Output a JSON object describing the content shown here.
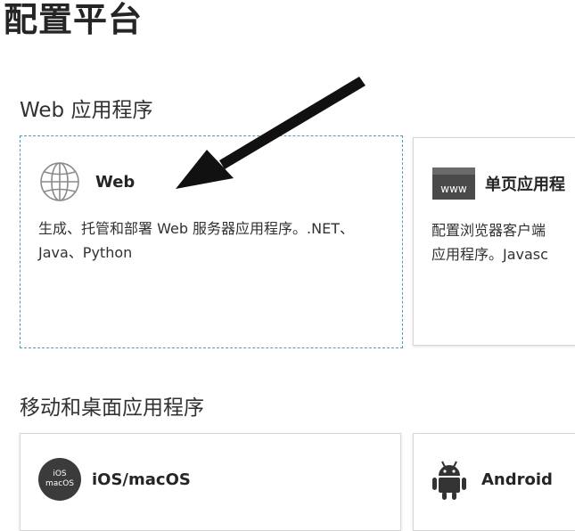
{
  "page": {
    "title": "配置平台"
  },
  "sections": {
    "web": {
      "title": "Web 应用程序",
      "cards": {
        "web": {
          "label": "Web",
          "icon": "globe-icon",
          "description": "生成、托管和部署 Web 服务器应用程序。.NET、Java、Python"
        },
        "spa": {
          "label": "单页应用程",
          "icon": "www-browser-icon",
          "icon_text": "www",
          "description_line1": "配置浏览器客户端",
          "description_line2": "应用程序。Javasc"
        }
      }
    },
    "mobile": {
      "title": "移动和桌面应用程序",
      "cards": {
        "ios": {
          "label": "iOS/macOS",
          "icon": "apple-ios-icon",
          "badge_line1": "iOS",
          "badge_line2": "macOS"
        },
        "android": {
          "label": "Android",
          "icon": "android-icon"
        }
      }
    }
  },
  "colors": {
    "focus_border": "#4aa0b5",
    "card_border": "#d6d6d6",
    "text": "#323130",
    "arrow": "#111111"
  }
}
